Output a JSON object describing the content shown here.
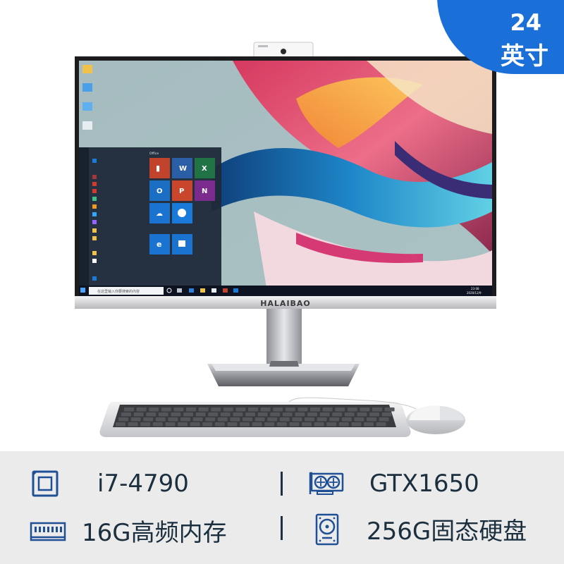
{
  "badge": {
    "size_number": "24",
    "size_unit": "英寸"
  },
  "brand_logo_text": "HALAIBAO",
  "screen": {
    "search_placeholder": "在这里输入你要搜索的内容",
    "start_menu": {
      "group_label": "Office",
      "tiles": [
        "Office",
        "Word",
        "Excel",
        "Outlook",
        "PowerPoint",
        "OneNote",
        "OneDrive",
        "Skype",
        "",
        "Microsoft Edge",
        "Microsoft Store"
      ],
      "apps": [
        "3D 查看器",
        "Access",
        "Adobe Acrobat DC",
        "Adobe Acrobat Distiller DC",
        "Adobe Dreamweaver CC 2019",
        "Adobe Illustrator CC 2019",
        "Adobe Photoshop CC 2019",
        "Adobe Premiere Pro CC 2019",
        "Autodesk",
        "阿里旺旺",
        "Bandizip",
        "便笺",
        "CAD快速看图"
      ]
    },
    "clock_time": "23:08",
    "clock_date": "2020/12/9"
  },
  "specs": [
    {
      "icon": "cpu-icon",
      "label": "i7-4790"
    },
    {
      "icon": "gpu-icon",
      "label": "GTX1650"
    },
    {
      "icon": "ram-icon",
      "label": "16G高频内存"
    },
    {
      "icon": "hdd-icon",
      "label": "256G固态硬盘"
    }
  ],
  "colors": {
    "badge_blue": "#1a6fd9",
    "spec_text": "#1b2f3f",
    "spec_bar": "#ebebeb",
    "icon_blue": "#1f4f94"
  }
}
